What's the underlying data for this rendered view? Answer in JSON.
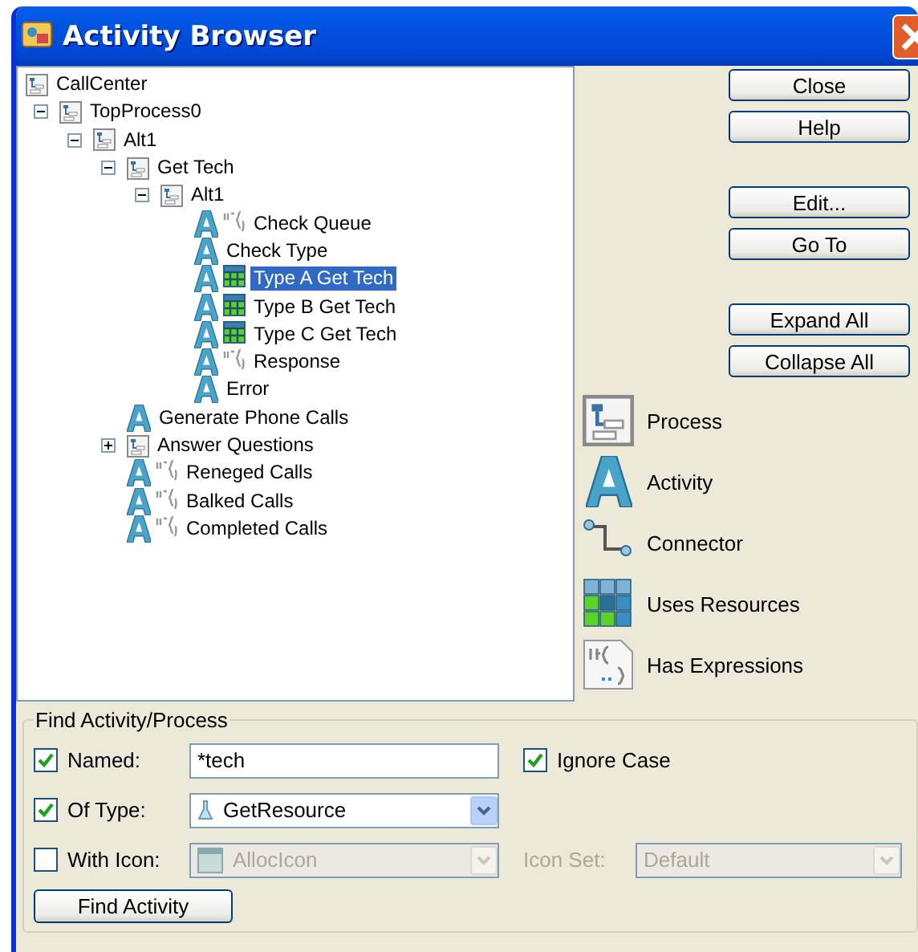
{
  "window": {
    "title": "Activity Browser"
  },
  "tree": [
    {
      "label": "CallCenter",
      "kind": "process",
      "selected": false,
      "children": [
        {
          "label": "TopProcess0",
          "kind": "process",
          "selected": false,
          "expanded": true,
          "children": [
            {
              "label": "Alt1",
              "kind": "process",
              "selected": false,
              "expanded": true,
              "children": [
                {
                  "label": "Get Tech",
                  "kind": "process",
                  "selected": false,
                  "expanded": true,
                  "children": [
                    {
                      "label": "Alt1",
                      "kind": "process",
                      "selected": false,
                      "expanded": true,
                      "children": [
                        {
                          "label": "Check Queue",
                          "kind": "activity",
                          "has_expressions": true,
                          "uses_resources": false,
                          "selected": false
                        },
                        {
                          "label": "Check Type",
                          "kind": "activity",
                          "has_expressions": false,
                          "uses_resources": false,
                          "selected": false
                        },
                        {
                          "label": "Type A Get Tech",
                          "kind": "activity",
                          "has_expressions": false,
                          "uses_resources": true,
                          "selected": true
                        },
                        {
                          "label": "Type B Get Tech",
                          "kind": "activity",
                          "has_expressions": false,
                          "uses_resources": true,
                          "selected": false
                        },
                        {
                          "label": "Type C Get Tech",
                          "kind": "activity",
                          "has_expressions": false,
                          "uses_resources": true,
                          "selected": false
                        },
                        {
                          "label": "Response",
                          "kind": "activity",
                          "has_expressions": true,
                          "uses_resources": false,
                          "selected": false
                        },
                        {
                          "label": "Error",
                          "kind": "activity",
                          "has_expressions": false,
                          "uses_resources": false,
                          "selected": false
                        }
                      ]
                    }
                  ]
                },
                {
                  "label": "Generate Phone Calls",
                  "kind": "activity",
                  "has_expressions": false,
                  "uses_resources": false,
                  "selected": false
                },
                {
                  "label": "Answer Questions",
                  "kind": "process",
                  "selected": false,
                  "expanded": false
                },
                {
                  "label": "Reneged Calls",
                  "kind": "activity",
                  "has_expressions": true,
                  "uses_resources": false,
                  "selected": false
                },
                {
                  "label": "Balked Calls",
                  "kind": "activity",
                  "has_expressions": true,
                  "uses_resources": false,
                  "selected": false
                },
                {
                  "label": "Completed Calls",
                  "kind": "activity",
                  "has_expressions": true,
                  "uses_resources": false,
                  "selected": false
                }
              ]
            }
          ]
        }
      ]
    }
  ],
  "button_groups": [
    [
      "Close",
      "Help"
    ],
    [
      "Edit...",
      "Go To"
    ],
    [
      "Expand All",
      "Collapse All"
    ]
  ],
  "legend": [
    {
      "kind": "process",
      "label": "Process"
    },
    {
      "kind": "activity",
      "label": "Activity"
    },
    {
      "kind": "connector",
      "label": "Connector"
    },
    {
      "kind": "resource",
      "label": "Uses Resources"
    },
    {
      "kind": "expression",
      "label": "Has Expressions"
    }
  ],
  "find": {
    "title": "Find Activity/Process",
    "named": {
      "label": "Named:",
      "checked": true,
      "value": "*tech"
    },
    "ignore_case": {
      "label": "Ignore Case",
      "checked": true
    },
    "of_type": {
      "label": "Of Type:",
      "checked": true,
      "value": "GetResource",
      "disabled": false
    },
    "with_icon": {
      "label": "With Icon:",
      "checked": false,
      "value": "AllocIcon",
      "disabled": true
    },
    "icon_set": {
      "label": "Icon Set:",
      "value": "Default",
      "disabled": true
    },
    "button": "Find Activity"
  }
}
